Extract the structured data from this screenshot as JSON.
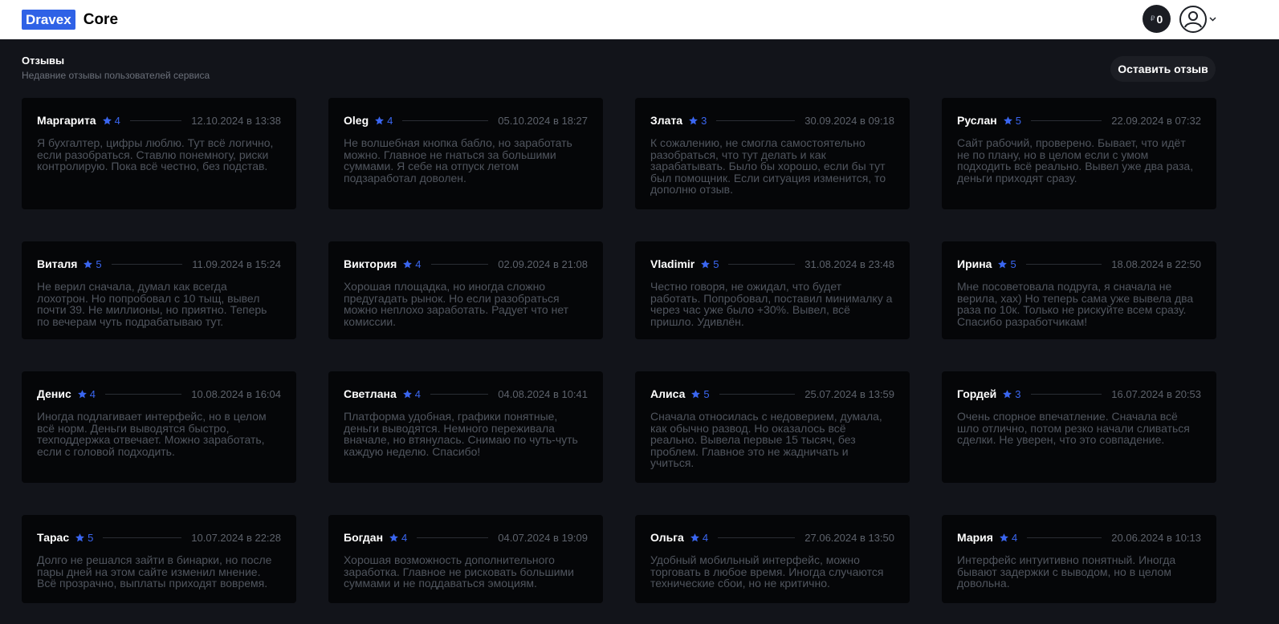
{
  "header": {
    "brand_badge": "Dravex",
    "brand_name": "Core",
    "balance_currency": "₽",
    "balance_value": "0"
  },
  "section": {
    "title": "Отзывы",
    "subtitle": "Недавние отзывы пользователей сервиса",
    "leave_review_label": "Оставить отзыв"
  },
  "colors": {
    "brand": "#2f62e6",
    "star": "#3a66f0",
    "background": "#12141a",
    "card": "#050608"
  },
  "reviews": [
    {
      "author": "Маргарита",
      "rating": "4",
      "date": "12.10.2024 в 13:38",
      "text": "Я бухгалтер, цифры люблю. Тут всё логично, если разобраться. Ставлю понемногу, риски контролирую. Пока всё честно, без подстав."
    },
    {
      "author": "Oleg",
      "rating": "4",
      "date": "05.10.2024 в 18:27",
      "text": "Не волшебная кнопка бабло, но заработать можно. Главное не гнаться за большими суммами. Я себе на отпуск летом подзаработал доволен."
    },
    {
      "author": "Злата",
      "rating": "3",
      "date": "30.09.2024 в 09:18",
      "text": "К сожалению, не смогла самостоятельно разобраться, что тут делать и как зарабатывать. Было бы хорошо, если бы тут был помощник. Если ситуация изменится, то дополню отзыв."
    },
    {
      "author": "Руслан",
      "rating": "5",
      "date": "22.09.2024 в 07:32",
      "text": "Сайт рабочий, проверено. Бывает, что идёт не по плану, но в целом если с умом подходить всё реально. Вывел уже два раза, деньги приходят сразу."
    },
    {
      "author": "Виталя",
      "rating": "5",
      "date": "11.09.2024 в 15:24",
      "text": "Не верил сначала, думал как всегда лохотрон. Но попробовал с 10 тыщ, вывел почти 39. Не миллионы, но приятно. Теперь по вечерам чуть подрабатываю тут."
    },
    {
      "author": "Виктория",
      "rating": "4",
      "date": "02.09.2024 в 21:08",
      "text": "Хорошая площадка, но иногда сложно предугадать рынок. Но если разобраться можно неплохо заработать. Радует что нет комиссии."
    },
    {
      "author": "Vladimir",
      "rating": "5",
      "date": "31.08.2024 в 23:48",
      "text": "Честно говоря, не ожидал, что будет работать. Попробовал, поставил минималку а через час уже было +30%. Вывел, всё пришло. Удивлён."
    },
    {
      "author": "Ирина",
      "rating": "5",
      "date": "18.08.2024 в 22:50",
      "text": "Мне посоветовала подруга, я сначала не верила, хах) Но теперь сама уже вывела два раза по 10к. Только не рискуйте всем сразу. Спасибо разработчикам!"
    },
    {
      "author": "Денис",
      "rating": "4",
      "date": "10.08.2024 в 16:04",
      "text": "Иногда подлагивает интерфейс, но в целом всё норм. Деньги выводятся быстро, техподдержка отвечает. Можно заработать, если с головой подходить."
    },
    {
      "author": "Светлана",
      "rating": "4",
      "date": "04.08.2024 в 10:41",
      "text": "Платформа удобная, графики понятные, деньги выводятся. Немного переживала вначале, но втянулась. Снимаю по чуть-чуть каждую неделю. Спасибо!"
    },
    {
      "author": "Алиса",
      "rating": "5",
      "date": "25.07.2024 в 13:59",
      "text": "Сначала относилась с недоверием, думала, как обычно развод. Но оказалось всё реально. Вывела первые 15 тысяч, без проблем. Главное это не жадничать и учиться."
    },
    {
      "author": "Гордей",
      "rating": "3",
      "date": "16.07.2024 в 20:53",
      "text": "Очень спорное впечатление. Сначала всё шло отлично, потом резко начали сливаться сделки. Не уверен, что это совпадение."
    },
    {
      "author": "Тарас",
      "rating": "5",
      "date": "10.07.2024 в 22:28",
      "text": "Долго не решался зайти в бинарки, но после пары дней на этом сайте изменил мнение. Всё прозрачно, выплаты приходят вовремя."
    },
    {
      "author": "Богдан",
      "rating": "4",
      "date": "04.07.2024 в 19:09",
      "text": "Хорошая возможность дополнительного заработка. Главное не рисковать большими суммами и не поддаваться эмоциям."
    },
    {
      "author": "Ольга",
      "rating": "4",
      "date": "27.06.2024 в 13:50",
      "text": "Удобный мобильный интерфейс, можно торговать в любое время. Иногда случаются технические сбои, но не критично."
    },
    {
      "author": "Мария",
      "rating": "4",
      "date": "20.06.2024 в 10:13",
      "text": "Интерфейс интуитивно понятный. Иногда бывают задержки с выводом, но в целом довольна."
    }
  ]
}
